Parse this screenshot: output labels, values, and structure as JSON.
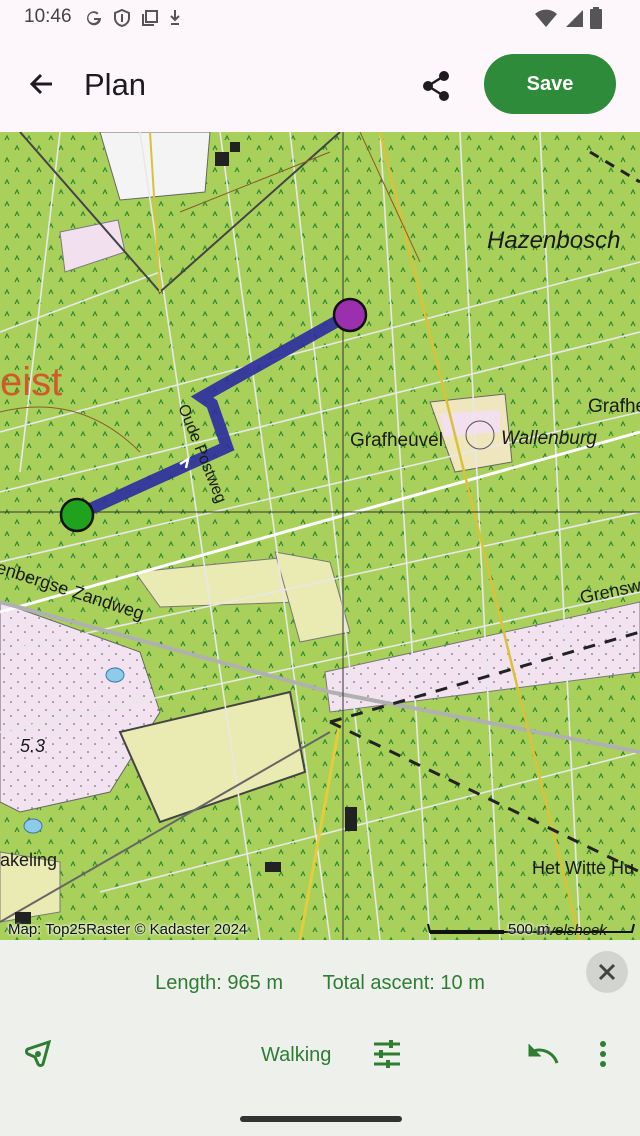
{
  "status_bar": {
    "time": "10:46",
    "left_icons": [
      "google-icon",
      "shield-icon",
      "copy-icon",
      "download-icon"
    ],
    "right_icons": [
      "wifi-icon",
      "signal-icon",
      "battery-icon"
    ]
  },
  "app_bar": {
    "title": "Plan",
    "save_label": "Save",
    "accent": "#2e8b39"
  },
  "map": {
    "labels": {
      "hazenbosch": "Hazenbosch",
      "zeist": "eist",
      "grafhe": "Grafhe",
      "grafheuvel": "Grafheuvel",
      "wallenburg": "Wallenburg",
      "oude_postweg": "Oude Postweg",
      "zandweg": "enbergse Zandweg",
      "grensw": "Grensw",
      "elevation": "5.3",
      "akeling": "akeling",
      "het_witte": "Het Witte Hu",
      "uivelshoek": "uivelshoek"
    },
    "attribution": "Map: Top25Raster © Kadaster 2024",
    "scale": "500 m",
    "route_color": "#2e2e9e",
    "start_color": "#1fa31f",
    "end_color": "#9b2fae"
  },
  "panel": {
    "length": "Length: 965 m",
    "ascent": "Total ascent: 10 m",
    "mode": "Walking"
  }
}
